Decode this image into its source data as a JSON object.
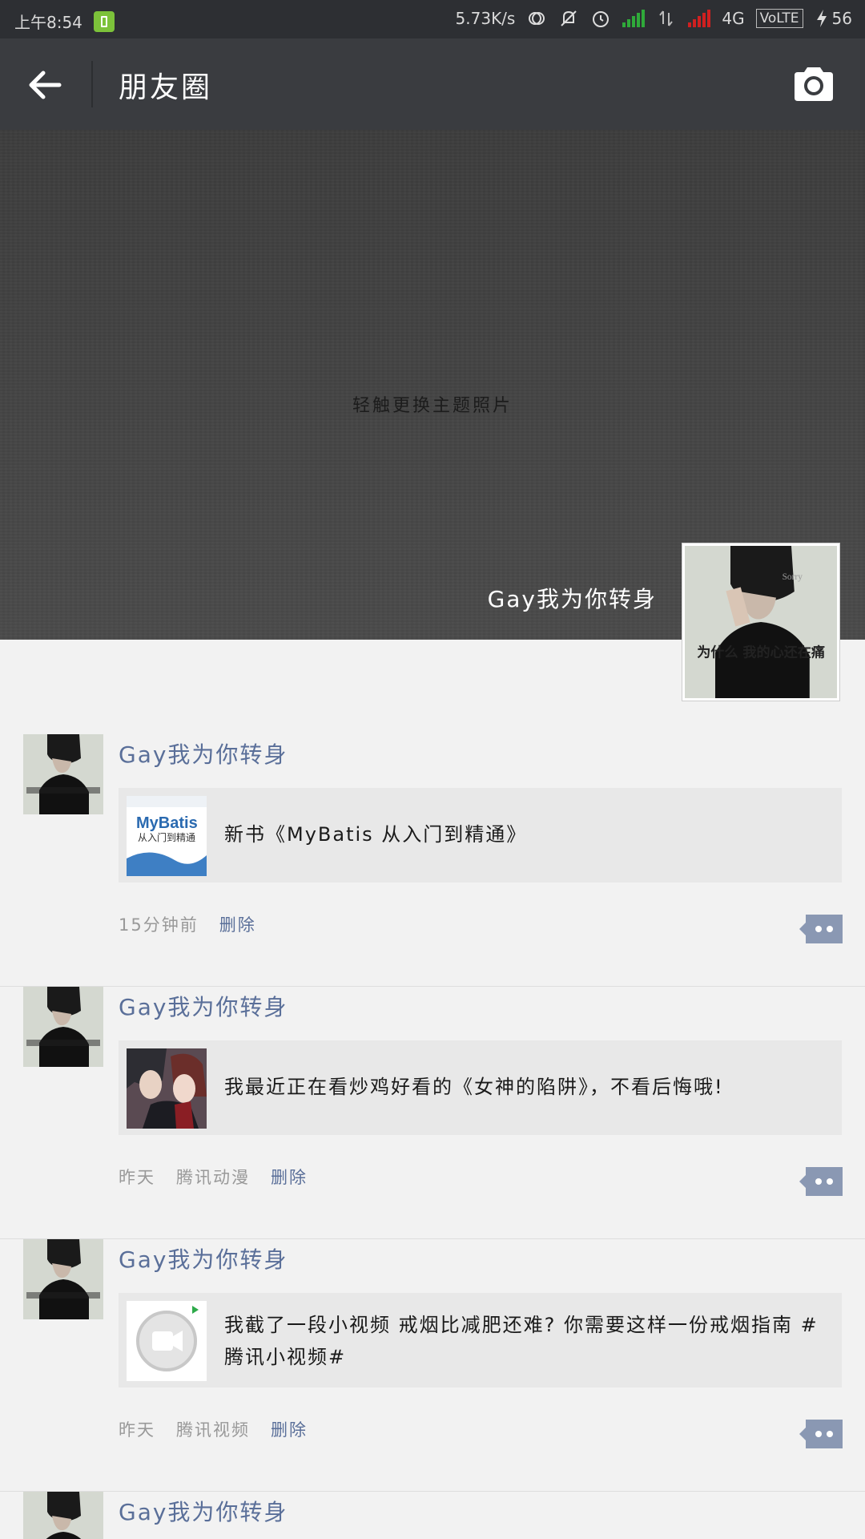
{
  "status_bar": {
    "time": "上午8:54",
    "speed": "5.73K/s",
    "network": "4G",
    "volte": "VoLTE",
    "battery": "56"
  },
  "app_bar": {
    "title": "朋友圈",
    "back_icon": "back-arrow-icon",
    "camera_icon": "camera-icon"
  },
  "cover": {
    "hint": "轻触更换主题照片",
    "user_name": "Gay我为你转身"
  },
  "posts": [
    {
      "user": "Gay我为你转身",
      "text": "新书《MyBatis 从入门到精通》",
      "time": "15分钟前",
      "source": "",
      "delete": "删除"
    },
    {
      "user": "Gay我为你转身",
      "text": "我最近正在看炒鸡好看的《女神的陷阱》，不看后悔哦!",
      "time": "昨天",
      "source": "腾讯动漫",
      "delete": "删除"
    },
    {
      "user": "Gay我为你转身",
      "text": "我截了一段小视频 戒烟比减肥还难? 你需要这样一份戒烟指南 #腾讯小视频#",
      "time": "昨天",
      "source": "腾讯视频",
      "delete": "删除"
    },
    {
      "user": "Gay我为你转身"
    }
  ],
  "thumb_1_title": "MyBatis",
  "thumb_1_subtitle": "从入门到精通",
  "avatar_caption": "为什么 我的心还在痛",
  "colors": {
    "link": "#5a6f99",
    "app_bar": "#3a3c40",
    "status_bar": "#2d2f33"
  }
}
